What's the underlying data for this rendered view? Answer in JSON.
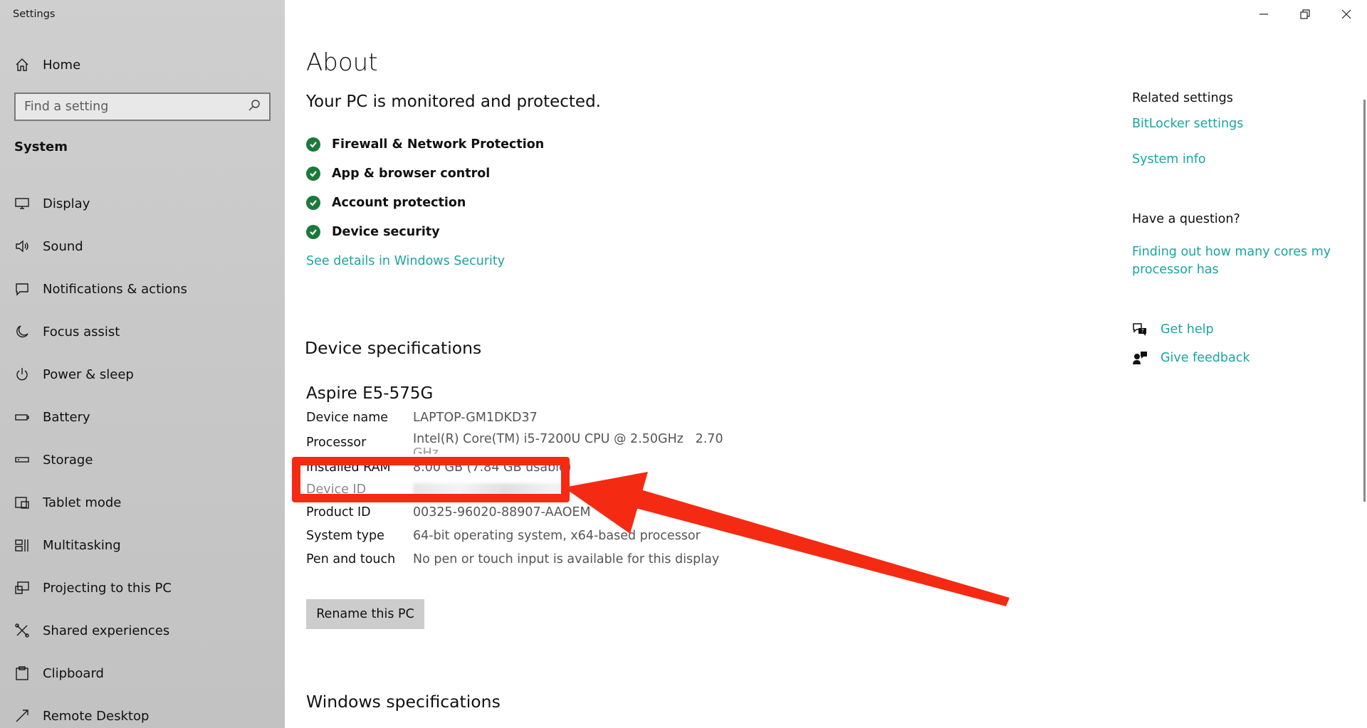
{
  "app": {
    "title": "Settings"
  },
  "sidebar": {
    "home_label": "Home",
    "search_placeholder": "Find a setting",
    "section": "System",
    "items": [
      {
        "label": "Display",
        "icon": "display-icon"
      },
      {
        "label": "Sound",
        "icon": "sound-icon"
      },
      {
        "label": "Notifications & actions",
        "icon": "notifications-icon"
      },
      {
        "label": "Focus assist",
        "icon": "moon-icon"
      },
      {
        "label": "Power & sleep",
        "icon": "power-icon"
      },
      {
        "label": "Battery",
        "icon": "battery-icon"
      },
      {
        "label": "Storage",
        "icon": "storage-icon"
      },
      {
        "label": "Tablet mode",
        "icon": "tablet-icon"
      },
      {
        "label": "Multitasking",
        "icon": "multitasking-icon"
      },
      {
        "label": "Projecting to this PC",
        "icon": "projecting-icon"
      },
      {
        "label": "Shared experiences",
        "icon": "shared-icon"
      },
      {
        "label": "Clipboard",
        "icon": "clipboard-icon"
      },
      {
        "label": "Remote Desktop",
        "icon": "remote-desktop-icon"
      }
    ]
  },
  "main": {
    "title": "About",
    "protected_heading": "Your PC is monitored and protected.",
    "protections": [
      "Firewall & Network Protection",
      "App & browser control",
      "Account protection",
      "Device security"
    ],
    "security_link": "See details in Windows Security",
    "device_spec_heading": "Device specifications",
    "device_model": "Aspire E5-575G",
    "specs": {
      "device_name": {
        "label": "Device name",
        "value": "LAPTOP-GM1DKD37"
      },
      "processor": {
        "label": "Processor",
        "value": "Intel(R) Core(TM) i5-7200U CPU @ 2.50GHz   2.70",
        "value_cont": "GHz"
      },
      "installed_ram": {
        "label": "Installed RAM",
        "value": "8.00 GB (7.84 GB usable)"
      },
      "device_id": {
        "label": "Device ID"
      },
      "product_id": {
        "label": "Product ID",
        "value": "00325-96020-88907-AAOEM"
      },
      "system_type": {
        "label": "System type",
        "value": "64-bit operating system, x64-based processor"
      },
      "pen_touch": {
        "label": "Pen and touch",
        "value": "No pen or touch input is available for this display"
      }
    },
    "rename_button": "Rename this PC",
    "windows_spec_heading": "Windows specifications"
  },
  "right": {
    "related_heading": "Related settings",
    "bitlocker_link": "BitLocker settings",
    "system_info_link": "System info",
    "question_heading": "Have a question?",
    "cores_link": "Finding out how many cores my processor has",
    "get_help": "Get help",
    "give_feedback": "Give feedback"
  },
  "colors": {
    "accent_link": "#1aa5a0",
    "check_green": "#1b7a3a",
    "annotation_red": "#f52a12"
  }
}
